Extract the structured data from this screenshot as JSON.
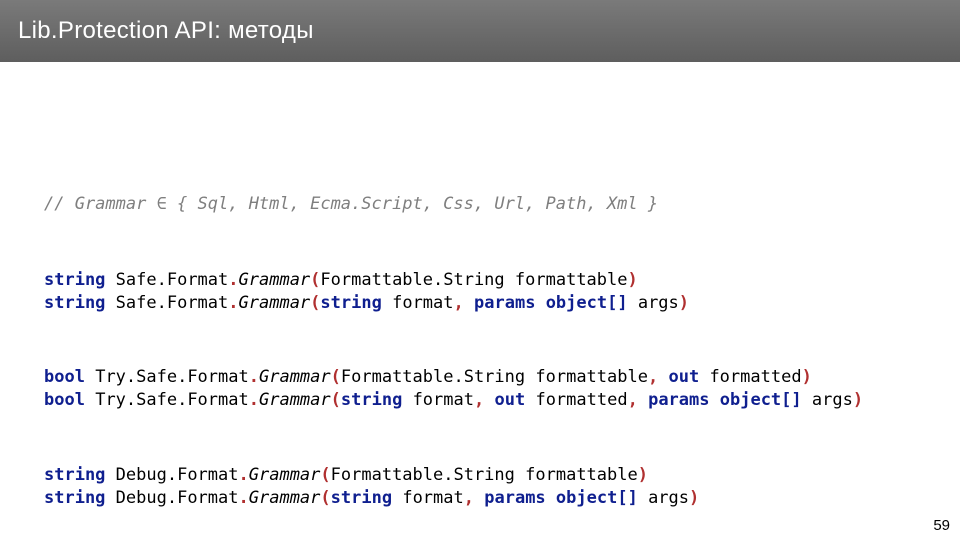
{
  "header": {
    "title": "Lib.Protection API: методы"
  },
  "code": {
    "comment": "// Grammar ∈ { Sql, Html, Ecma.Script, Css, Url, Path, Xml }",
    "kw_string": "string",
    "kw_bool": "bool",
    "kw_params": "params",
    "kw_object_arr": "object[]",
    "kw_out": "out",
    "name_SafeFormat": "Safe.Format",
    "name_TrySafeFormat": "Try.Safe.Format",
    "name_DebugFormat": "Debug.Format",
    "grammar": "Grammar",
    "FormattableString": "Formattable.String",
    "formattable": "formattable",
    "format": "format",
    "formatted": "formatted",
    "args": "args",
    "dot": ".",
    "lparen": "(",
    "rparen": ")",
    "comma": ",",
    "sp": " "
  },
  "slide_number": "59"
}
